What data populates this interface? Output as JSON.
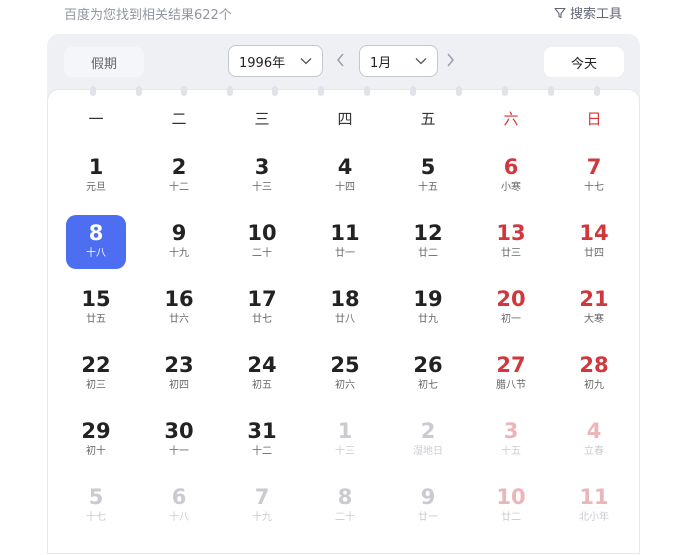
{
  "results": {
    "count_text": "百度为您找到相关结果622个"
  },
  "tools": {
    "label": "搜索工具"
  },
  "calendar": {
    "holiday_label": "假期",
    "year_value": "1996年",
    "month_value": "1月",
    "today_label": "今天",
    "weekdays": [
      "一",
      "二",
      "三",
      "四",
      "五",
      "六",
      "日"
    ],
    "colors": {
      "accent": "#4e6ef2",
      "weekend": "#d1383d"
    },
    "weeks": [
      [
        {
          "d": "1",
          "l": "元旦"
        },
        {
          "d": "2",
          "l": "十二"
        },
        {
          "d": "3",
          "l": "十三"
        },
        {
          "d": "4",
          "l": "十四"
        },
        {
          "d": "5",
          "l": "十五"
        },
        {
          "d": "6",
          "l": "小寒"
        },
        {
          "d": "7",
          "l": "十七"
        }
      ],
      [
        {
          "d": "8",
          "l": "十八"
        },
        {
          "d": "9",
          "l": "十九"
        },
        {
          "d": "10",
          "l": "二十"
        },
        {
          "d": "11",
          "l": "廿一"
        },
        {
          "d": "12",
          "l": "廿二"
        },
        {
          "d": "13",
          "l": "廿三"
        },
        {
          "d": "14",
          "l": "廿四"
        }
      ],
      [
        {
          "d": "15",
          "l": "廿五"
        },
        {
          "d": "16",
          "l": "廿六"
        },
        {
          "d": "17",
          "l": "廿七"
        },
        {
          "d": "18",
          "l": "廿八"
        },
        {
          "d": "19",
          "l": "廿九"
        },
        {
          "d": "20",
          "l": "初一"
        },
        {
          "d": "21",
          "l": "大寒"
        }
      ],
      [
        {
          "d": "22",
          "l": "初三"
        },
        {
          "d": "23",
          "l": "初四"
        },
        {
          "d": "24",
          "l": "初五"
        },
        {
          "d": "25",
          "l": "初六"
        },
        {
          "d": "26",
          "l": "初七"
        },
        {
          "d": "27",
          "l": "腊八节"
        },
        {
          "d": "28",
          "l": "初九"
        }
      ],
      [
        {
          "d": "29",
          "l": "初十"
        },
        {
          "d": "30",
          "l": "十一"
        },
        {
          "d": "31",
          "l": "十二"
        },
        {
          "d": "1",
          "l": "十三",
          "other": true
        },
        {
          "d": "2",
          "l": "湿地日",
          "other": true
        },
        {
          "d": "3",
          "l": "十五",
          "other": true
        },
        {
          "d": "4",
          "l": "立春",
          "other": true
        }
      ],
      [
        {
          "d": "5",
          "l": "十七",
          "other": true
        },
        {
          "d": "6",
          "l": "十八",
          "other": true
        },
        {
          "d": "7",
          "l": "十九",
          "other": true
        },
        {
          "d": "8",
          "l": "二十",
          "other": true
        },
        {
          "d": "9",
          "l": "廿一",
          "other": true
        },
        {
          "d": "10",
          "l": "廿二",
          "other": true
        },
        {
          "d": "11",
          "l": "北小年",
          "other": true
        }
      ]
    ],
    "selected_day": "8"
  }
}
